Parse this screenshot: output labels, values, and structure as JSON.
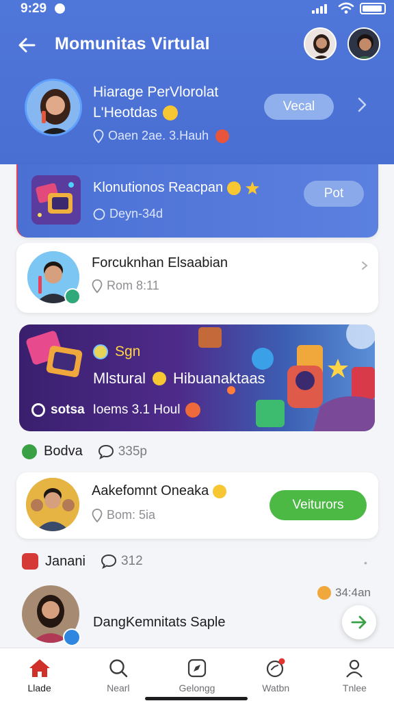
{
  "status_bar": {
    "time": "9:29"
  },
  "header": {
    "back_icon": "arrow-left-icon",
    "title": "Momunitas Virtulal",
    "hero": {
      "name_line1": "Hiarage PerVlorolat",
      "name_line2": "L'Heotdas",
      "meta": "Oaen 2ae. 3.Hauh",
      "action_label": "Vecal"
    }
  },
  "cards": {
    "featured": {
      "title": "Klonutionos Reacpan",
      "meta": "Deyn-34d",
      "action_label": "Pot"
    },
    "person": {
      "name": "Forcuknhan Elsaabian",
      "meta": "Rom 8:11"
    },
    "banner": {
      "tag": "Sgn",
      "title": "Mlstural",
      "title2": "Hibuanaktaas",
      "footer_brand": "sotsa",
      "footer_meta": "Ioems 3.1 Houl"
    },
    "section1": {
      "label": "Bodva",
      "count": "335p"
    },
    "member": {
      "name": "Aakefomnt Oneaka",
      "meta": "Bom: 5ia",
      "action_label": "Veiturors"
    },
    "section2": {
      "label": "Janani",
      "count": "312"
    },
    "last": {
      "name": "DangKemnitats Saple",
      "time": "34:4an"
    }
  },
  "bottom_nav": [
    {
      "label": "Llade",
      "icon": "home-icon"
    },
    {
      "label": "Nearl",
      "icon": "search-icon"
    },
    {
      "label": "Gelongg",
      "icon": "compass-icon"
    },
    {
      "label": "Watbn",
      "icon": "notification-icon"
    },
    {
      "label": "Tnlee",
      "icon": "profile-icon"
    }
  ],
  "colors": {
    "header_blue": "#4f76d9",
    "accent_green": "#4cb944",
    "nav_active": "#d0302a"
  }
}
